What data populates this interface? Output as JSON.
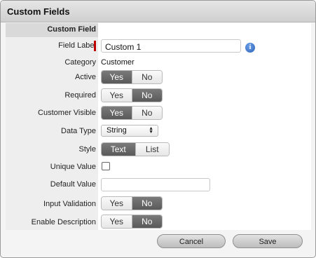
{
  "dialog": {
    "title": "Custom Fields"
  },
  "section": {
    "header": "Custom Field"
  },
  "fields": {
    "field_label": {
      "label": "Field Label",
      "value": "Custom 1"
    },
    "category": {
      "label": "Category",
      "value": "Customer"
    },
    "active": {
      "label": "Active",
      "on": "Yes",
      "off": "No",
      "selected": "Yes"
    },
    "required": {
      "label": "Required",
      "on": "Yes",
      "off": "No",
      "selected": "No"
    },
    "customer_visible": {
      "label": "Customer Visible",
      "on": "Yes",
      "off": "No",
      "selected": "Yes"
    },
    "data_type": {
      "label": "Data Type",
      "value": "String"
    },
    "style": {
      "label": "Style",
      "on": "Text",
      "off": "List",
      "selected": "Text"
    },
    "unique_value": {
      "label": "Unique Value",
      "checked": false
    },
    "default_value": {
      "label": "Default Value",
      "value": ""
    },
    "input_validation": {
      "label": "Input Validation",
      "on": "Yes",
      "off": "No",
      "selected": "No"
    },
    "enable_description": {
      "label": "Enable Description",
      "on": "Yes",
      "off": "No",
      "selected": "No"
    }
  },
  "icons": {
    "info": "info-icon",
    "required_marker": "required-marker"
  },
  "buttons": {
    "cancel": "Cancel",
    "save": "Save"
  }
}
